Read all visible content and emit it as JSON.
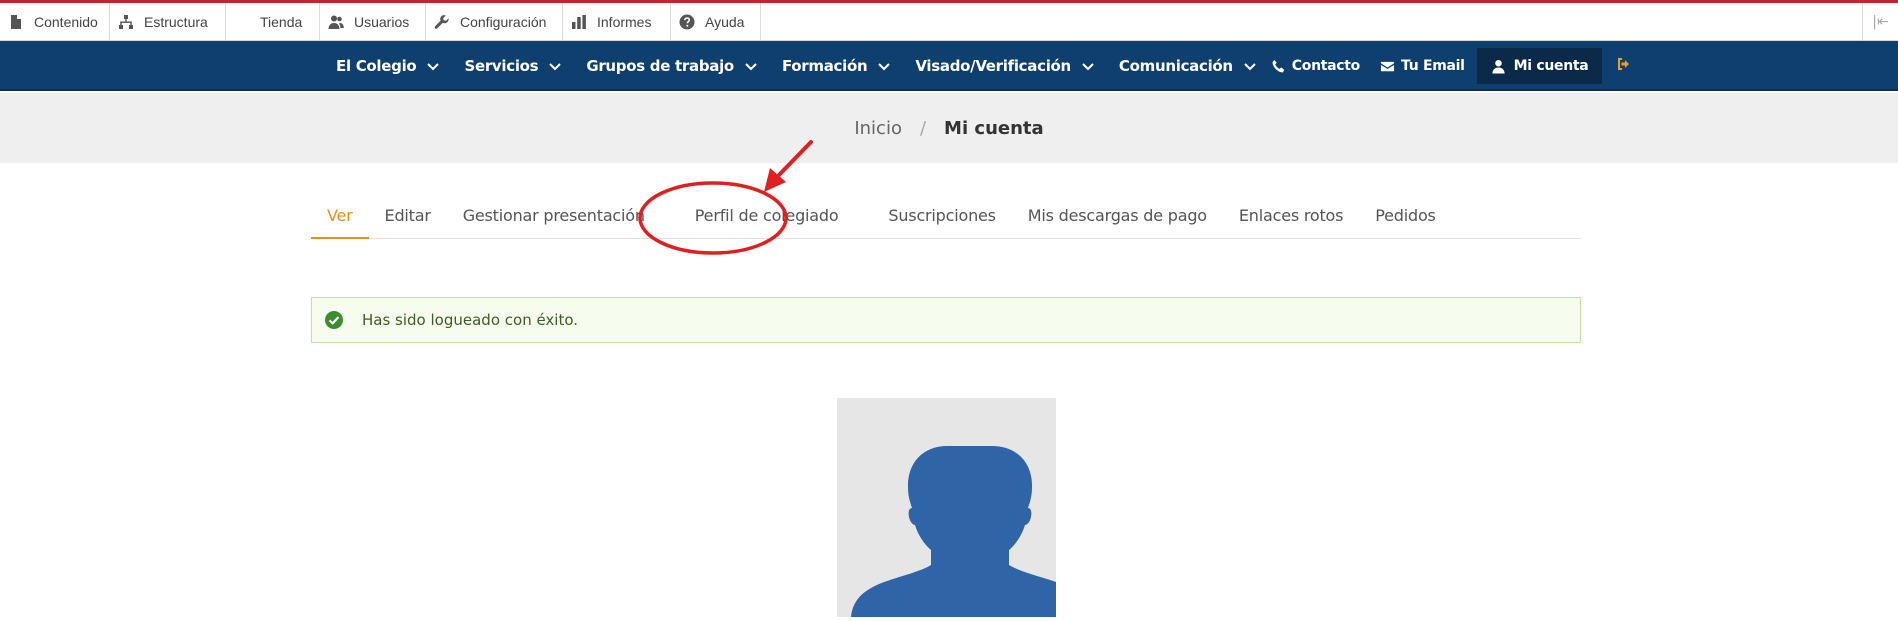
{
  "admin_toolbar": {
    "items": [
      {
        "label": "Contenido",
        "icon": "file-icon"
      },
      {
        "label": "Estructura",
        "icon": "sitemap-icon"
      },
      {
        "label": "Tienda",
        "icon": ""
      },
      {
        "label": "Usuarios",
        "icon": "users-icon"
      },
      {
        "label": "Configuración",
        "icon": "wrench-icon"
      },
      {
        "label": "Informes",
        "icon": "bar-chart-icon"
      },
      {
        "label": "Ayuda",
        "icon": "help-icon"
      }
    ],
    "collapse_glyph": "|⇤"
  },
  "main_nav": {
    "menus": [
      "El Colegio",
      "Servicios",
      "Grupos de trabajo",
      "Formación",
      "Visado/Verificación",
      "Comunicación"
    ],
    "contact_label": "Contacto",
    "email_label": "Tu Email",
    "account_label": "Mi cuenta"
  },
  "breadcrumb": {
    "home": "Inicio",
    "separator": "/",
    "current": "Mi cuenta"
  },
  "tabs": [
    {
      "label": "Ver",
      "active": true
    },
    {
      "label": "Editar",
      "active": false
    },
    {
      "label": "Gestionar presentación",
      "active": false
    },
    {
      "label": "Perfil de colegiado",
      "active": false
    },
    {
      "label": "Suscripciones",
      "active": false
    },
    {
      "label": "Mis descargas de pago",
      "active": false
    },
    {
      "label": "Enlaces rotos",
      "active": false
    },
    {
      "label": "Pedidos",
      "active": false
    }
  ],
  "status_message": "Has sido logueado con éxito.",
  "colors": {
    "nav_bg": "#0f3f6f",
    "accent": "#e8901a",
    "annotation": "#e02020",
    "success_border": "#bde59e",
    "avatar_silhouette": "#2f65a7"
  }
}
